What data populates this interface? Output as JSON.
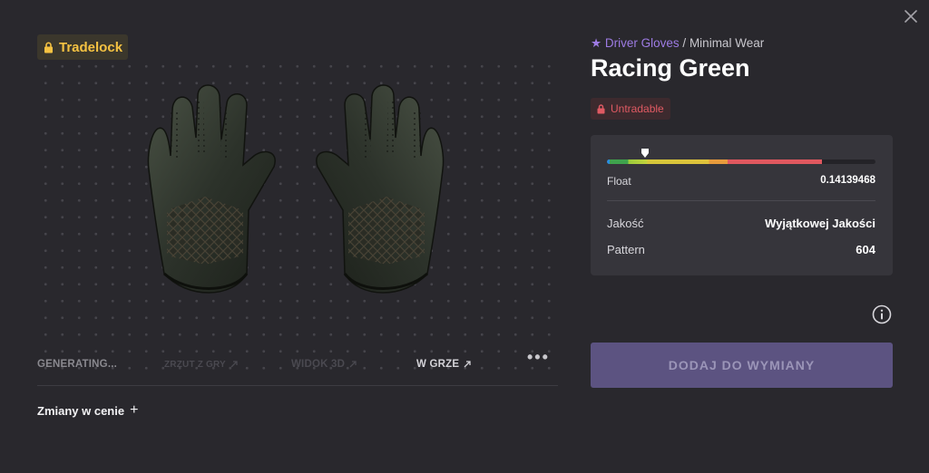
{
  "modal": {
    "close_icon": "close-icon"
  },
  "left": {
    "tradelock_label": "Tradelock",
    "actions": {
      "generating": "GENERATING...",
      "zrzut": "ZRZUT Z GRY",
      "widok": "WIDOK 3D",
      "w_grze": "W GRZE",
      "more": "•••"
    },
    "zmiany_label": "Zmiany w cenie",
    "zmiany_icon": "+"
  },
  "item": {
    "type_prefix": "★",
    "type": "Driver Gloves",
    "separator": "/",
    "wear": "Minimal Wear",
    "name": "Racing Green",
    "untradable_label": "Untradable",
    "float_fraction": 0.1414,
    "details": {
      "float_label": "Float",
      "float_value": "0.14139468",
      "quality_label": "Jakość",
      "quality_value": "Wyjątkowej Jakości",
      "pattern_label": "Pattern",
      "pattern_value": "604"
    }
  },
  "cta": {
    "label": "DODAJ DO WYMIANY"
  },
  "colors": {
    "background": "#29282d",
    "card": "#36353b",
    "accent_purple": "#9d7be3",
    "button": "#5c5381",
    "tradelock_yellow": "#f5c242",
    "untradable_red": "#e05a63"
  }
}
